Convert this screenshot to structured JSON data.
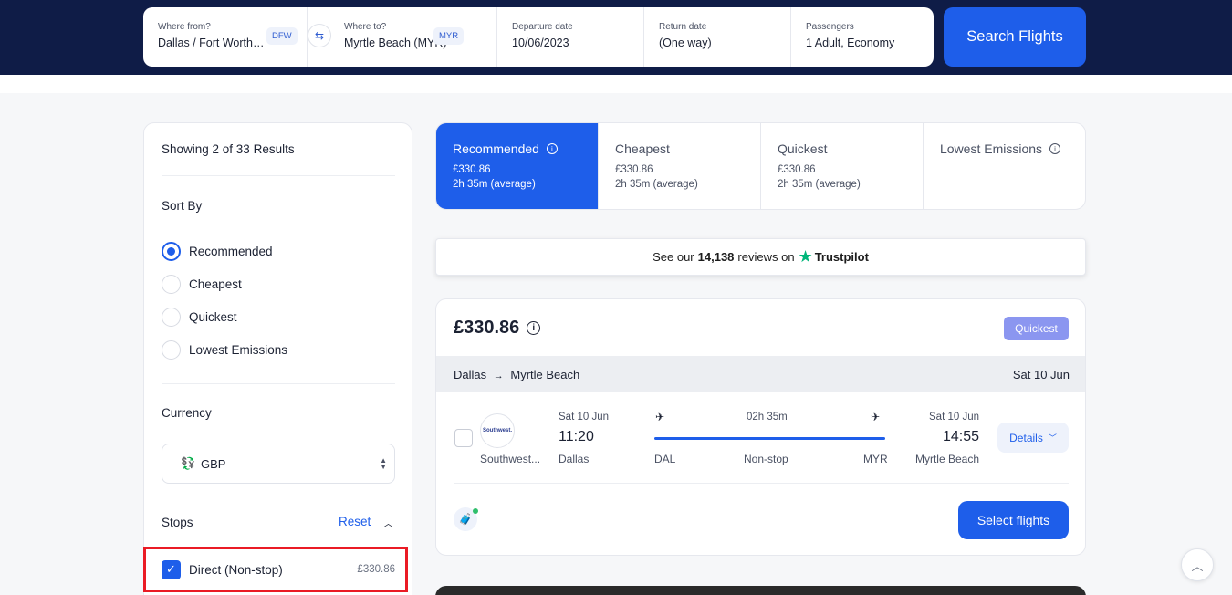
{
  "search": {
    "from_label": "Where from?",
    "from_value": "Dallas / Fort Worth I...",
    "from_code": "DFW",
    "to_label": "Where to?",
    "to_value": "Myrtle Beach (MYR)",
    "to_code": "MYR",
    "departure_label": "Departure date",
    "departure_value": "10/06/2023",
    "return_label": "Return date",
    "return_value": "(One way)",
    "passengers_label": "Passengers",
    "passengers_value": "1 Adult, Economy",
    "search_button": "Search Flights"
  },
  "sidebar": {
    "results_count": "Showing 2 of 33 Results",
    "sort_title": "Sort By",
    "sort_options": [
      "Recommended",
      "Cheapest",
      "Quickest",
      "Lowest Emissions"
    ],
    "sort_selected": "Recommended",
    "currency_title": "Currency",
    "currency_value": "GBP",
    "stops_title": "Stops",
    "stops_reset": "Reset",
    "direct_label": "Direct (Non-stop)",
    "direct_price": "£330.86"
  },
  "tabs": [
    {
      "title": "Recommended",
      "price": "£330.86",
      "duration": "2h 35m (average)",
      "active": true
    },
    {
      "title": "Cheapest",
      "price": "£330.86",
      "duration": "2h 35m (average)",
      "active": false
    },
    {
      "title": "Quickest",
      "price": "£330.86",
      "duration": "2h 35m (average)",
      "active": false
    },
    {
      "title": "Lowest Emissions",
      "price": "",
      "duration": "",
      "active": false
    }
  ],
  "trustpilot": {
    "prefix": "See our",
    "count": "14,138",
    "mid": "reviews on",
    "brand": "Trustpilot"
  },
  "result": {
    "price": "£330.86",
    "badge": "Quickest",
    "route_from": "Dallas",
    "route_to": "Myrtle Beach",
    "route_date": "Sat 10 Jun",
    "airline_logo_text": "Southwest.",
    "airline_name": "Southwest...",
    "dep_date": "Sat 10 Jun",
    "dep_time": "11:20",
    "dep_city": "Dallas",
    "duration": "02h 35m",
    "from_code": "DAL",
    "stops": "Non-stop",
    "to_code": "MYR",
    "arr_date": "Sat 10 Jun",
    "arr_time": "14:55",
    "arr_city": "Myrtle Beach",
    "details_button": "Details",
    "select_button": "Select flights"
  },
  "colors": {
    "header_bg": "#0f1c47",
    "accent": "#1e5eea",
    "badge": "#8b96f0",
    "highlight": "#ea1b25",
    "trustpilot_star": "#00b67a"
  }
}
